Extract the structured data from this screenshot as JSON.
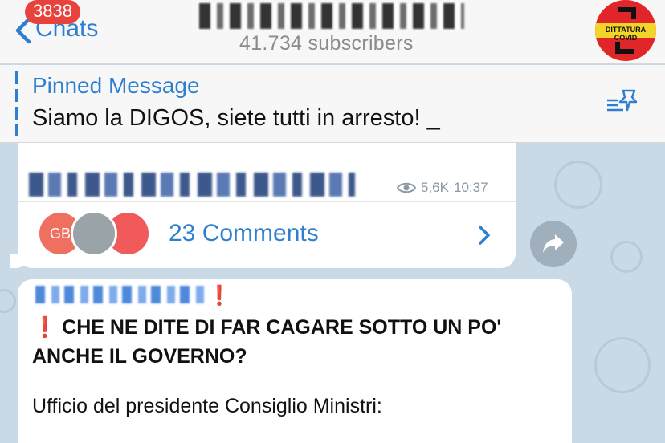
{
  "header": {
    "back_label": "Chats",
    "unread_badge": "3838",
    "subscribers": "41.734 subscribers",
    "avatar_text": "DITTATURA COVID",
    "accent": "#2f7fd1"
  },
  "pinned": {
    "title": "Pinned Message",
    "text": "Siamo la DIGOS, siete tutti in arresto! _"
  },
  "message1": {
    "views": "5,6K",
    "time": "10:37",
    "commenter_initials": "GB",
    "comments_label": "23 Comments"
  },
  "message2": {
    "exclamation": "❗",
    "bold_text": "CHE NE DITE DI FAR CAGARE SOTTO UN PO' ANCHE IL GOVERNO?",
    "line": "Ufficio del presidente Consiglio Ministri:"
  }
}
